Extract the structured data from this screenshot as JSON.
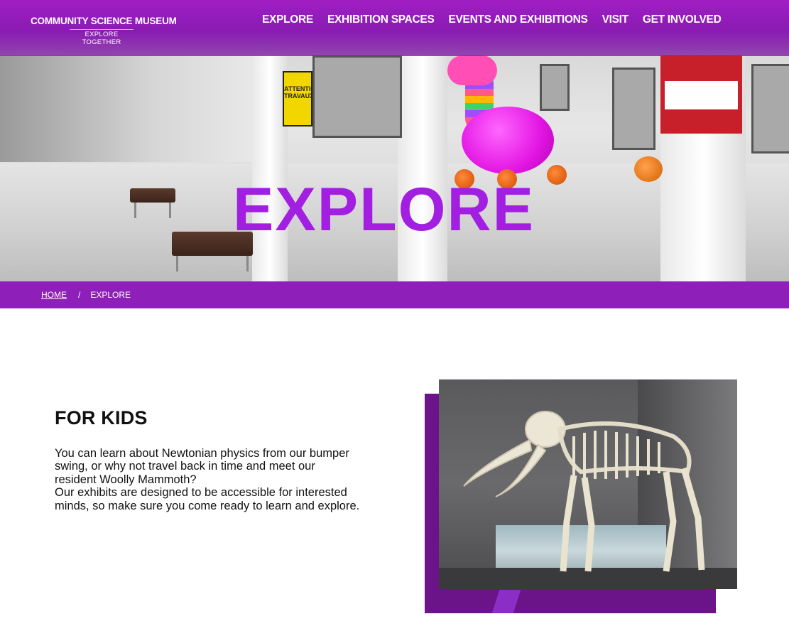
{
  "site": {
    "logo_title": "COMMUNITY SCIENCE MUSEUM",
    "logo_tagline": "EXPLORE TOGETHER"
  },
  "nav": {
    "items": [
      {
        "label": "EXPLORE"
      },
      {
        "label": "EXHIBITION SPACES"
      },
      {
        "label": "EVENTS AND EXHIBITIONS"
      },
      {
        "label": "VISIT"
      },
      {
        "label": "GET INVOLVED"
      }
    ]
  },
  "hero": {
    "title": "EXPLORE",
    "sign_text": "ATTENTION TRAVAUX"
  },
  "breadcrumb": {
    "home": "HOME",
    "separator": "/",
    "current": "EXPLORE"
  },
  "content": {
    "title": "FOR KIDS",
    "paragraph1": "You can learn about Newtonian physics from our bumper swing, or why not travel back in time and meet our resident Woolly Mammoth?",
    "paragraph2": "Our exhibits are designed to be accessible for interested minds, so make sure you come ready to learn and explore."
  },
  "colors": {
    "brand_purple": "#8e1fb8",
    "accent_dark_purple": "#6b1388",
    "hero_title_purple": "#a21ee0"
  }
}
